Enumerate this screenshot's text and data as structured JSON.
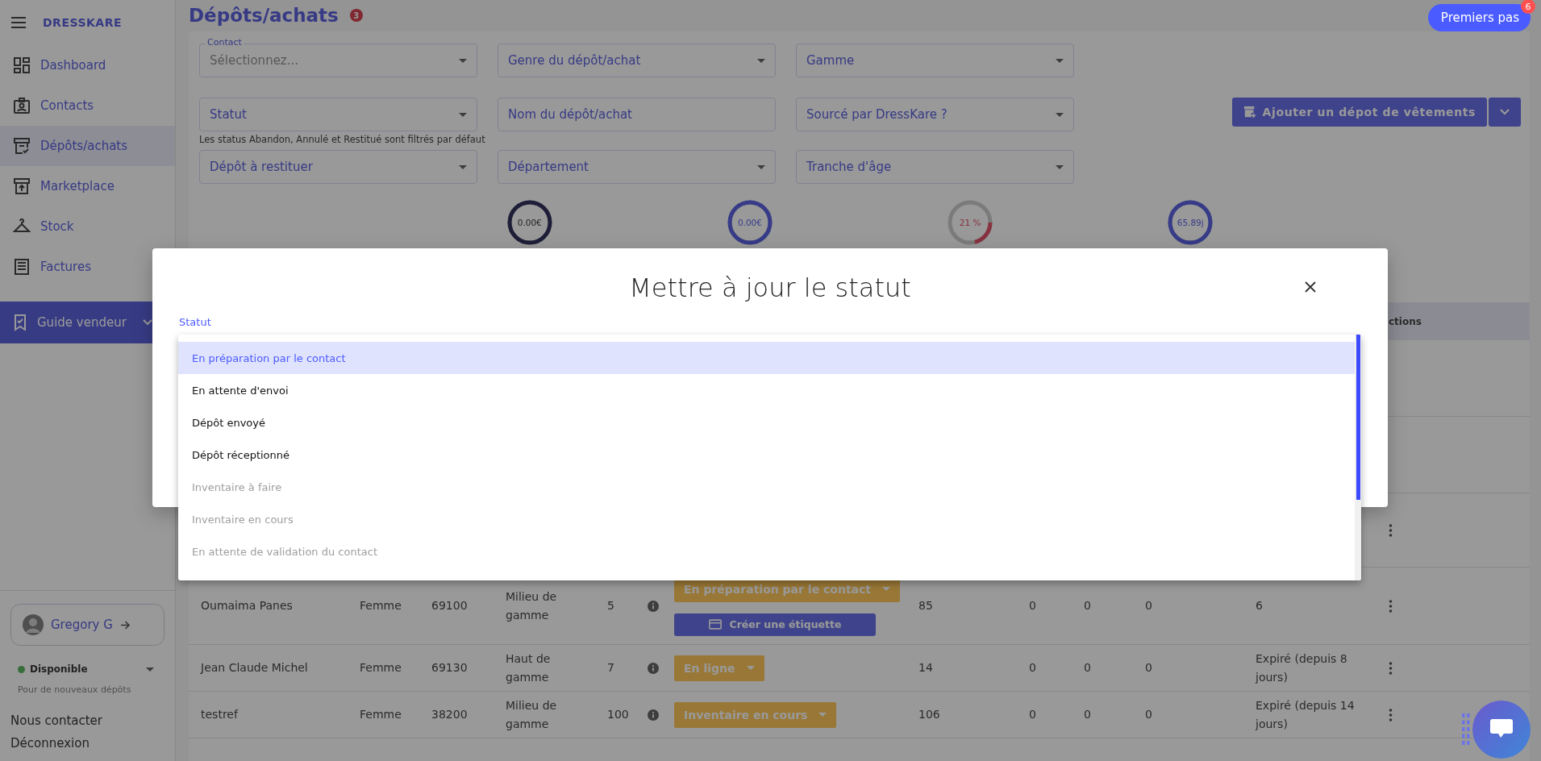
{
  "sidebar": {
    "brand": "DRESSKARE",
    "items": [
      {
        "label": "Dashboard",
        "selected": false
      },
      {
        "label": "Contacts",
        "selected": false
      },
      {
        "label": "Dépôts/achats",
        "selected": true
      },
      {
        "label": "Marketplace",
        "selected": false
      },
      {
        "label": "Stock",
        "selected": false
      },
      {
        "label": "Factures",
        "selected": false
      }
    ],
    "guide": "Guide vendeur",
    "user": "Gregory G",
    "availability": {
      "label": "Disponible",
      "on": true,
      "note": "Pour de nouveaux dépôts"
    },
    "links": [
      "Nous contacter",
      "Déconnexion"
    ]
  },
  "header": {
    "title": "Dépôts/achats",
    "badge": "3",
    "help_button": "Premiers pas",
    "help_badge": "6"
  },
  "filters": [
    {
      "kind": "select",
      "label": "Contact",
      "placeholder": "Sélectionnez..."
    },
    {
      "kind": "select",
      "placeholder": "Genre du dépôt/achat"
    },
    {
      "kind": "select",
      "placeholder": "Gamme"
    },
    {
      "kind": "select",
      "placeholder": "Statut"
    },
    {
      "kind": "text",
      "placeholder": "Nom du dépôt/achat"
    },
    {
      "kind": "select",
      "placeholder": "Sourcé par DressKare ?"
    },
    {
      "kind": "select",
      "placeholder": "Dépôt à restituer"
    },
    {
      "kind": "select",
      "placeholder": "Département"
    },
    {
      "kind": "select",
      "placeholder": "Tranche d'âge"
    }
  ],
  "filter_note": "Les status Abandon, Annulé et Restitué sont filtrés par défaut",
  "add_button": "Ajouter un dépot de vêtements",
  "stats": [
    {
      "kind": "balance",
      "value": "0.00€"
    },
    {
      "kind": "amount",
      "value": "0.00€"
    },
    {
      "kind": "rate",
      "value": "21 %"
    },
    {
      "kind": "duration",
      "value": "65.89j"
    }
  ],
  "table": {
    "columns": [
      {
        "label": "ctions"
      }
    ],
    "rows": [
      {
        "contact": "Oumaima Panes",
        "genre": "Femme",
        "postal_code": "69100",
        "gamme": "Milieu de gamme",
        "count": "5",
        "status": "En préparation par le contact",
        "label_button": "Créer une étiquette",
        "column_8": "85",
        "column_9": "0",
        "column_10": "0",
        "column_11": "0",
        "column_12": "6"
      },
      {
        "contact": "Jean Claude Michel",
        "genre": "Femme",
        "postal_code": "69130",
        "gamme": "Haut de gamme",
        "count": "7",
        "status": "En ligne",
        "column_8": "14",
        "column_9": "0",
        "column_10": "0",
        "column_11": "0",
        "column_12": "Expiré (depuis 8 jours)"
      },
      {
        "contact": "testref",
        "genre": "Femme",
        "postal_code": "38200",
        "gamme": "Milieu de gamme",
        "count": "100",
        "status": "Inventaire en cours",
        "column_8": "106",
        "column_9": "0",
        "column_10": "0",
        "column_11": "0",
        "column_12": "Expiré (depuis 14 jours)"
      }
    ]
  },
  "modal": {
    "title": "Mettre à jour le statut",
    "field_label": "Statut",
    "options": [
      {
        "label": "En préparation par le contact",
        "selected": true,
        "disabled": false
      },
      {
        "label": "En attente d'envoi",
        "selected": false,
        "disabled": false
      },
      {
        "label": "Dépôt envoyé",
        "selected": false,
        "disabled": false
      },
      {
        "label": "Dépôt réceptionné",
        "selected": false,
        "disabled": false
      },
      {
        "label": "Inventaire à faire",
        "selected": false,
        "disabled": true
      },
      {
        "label": "Inventaire en cours",
        "selected": false,
        "disabled": true
      },
      {
        "label": "En attente de validation du contact",
        "selected": false,
        "disabled": true
      }
    ]
  }
}
